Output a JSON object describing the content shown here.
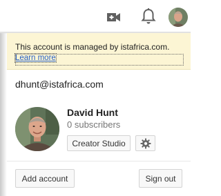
{
  "topbar": {
    "upload_icon": "video-camera-plus-icon",
    "notification_icon": "bell-icon",
    "avatar": "user-avatar"
  },
  "notice": {
    "text": "This account is managed by istafrica.com.",
    "link_label": "Learn more",
    "background": "#fcf5d4",
    "link_color": "#2a62c5"
  },
  "account": {
    "email": "dhunt@istafrica.com",
    "name": "David Hunt",
    "subscribers": "0 subscribers"
  },
  "buttons": {
    "creator_studio": "Creator Studio",
    "settings_icon": "gear-icon",
    "add_account": "Add account",
    "sign_out": "Sign out"
  }
}
